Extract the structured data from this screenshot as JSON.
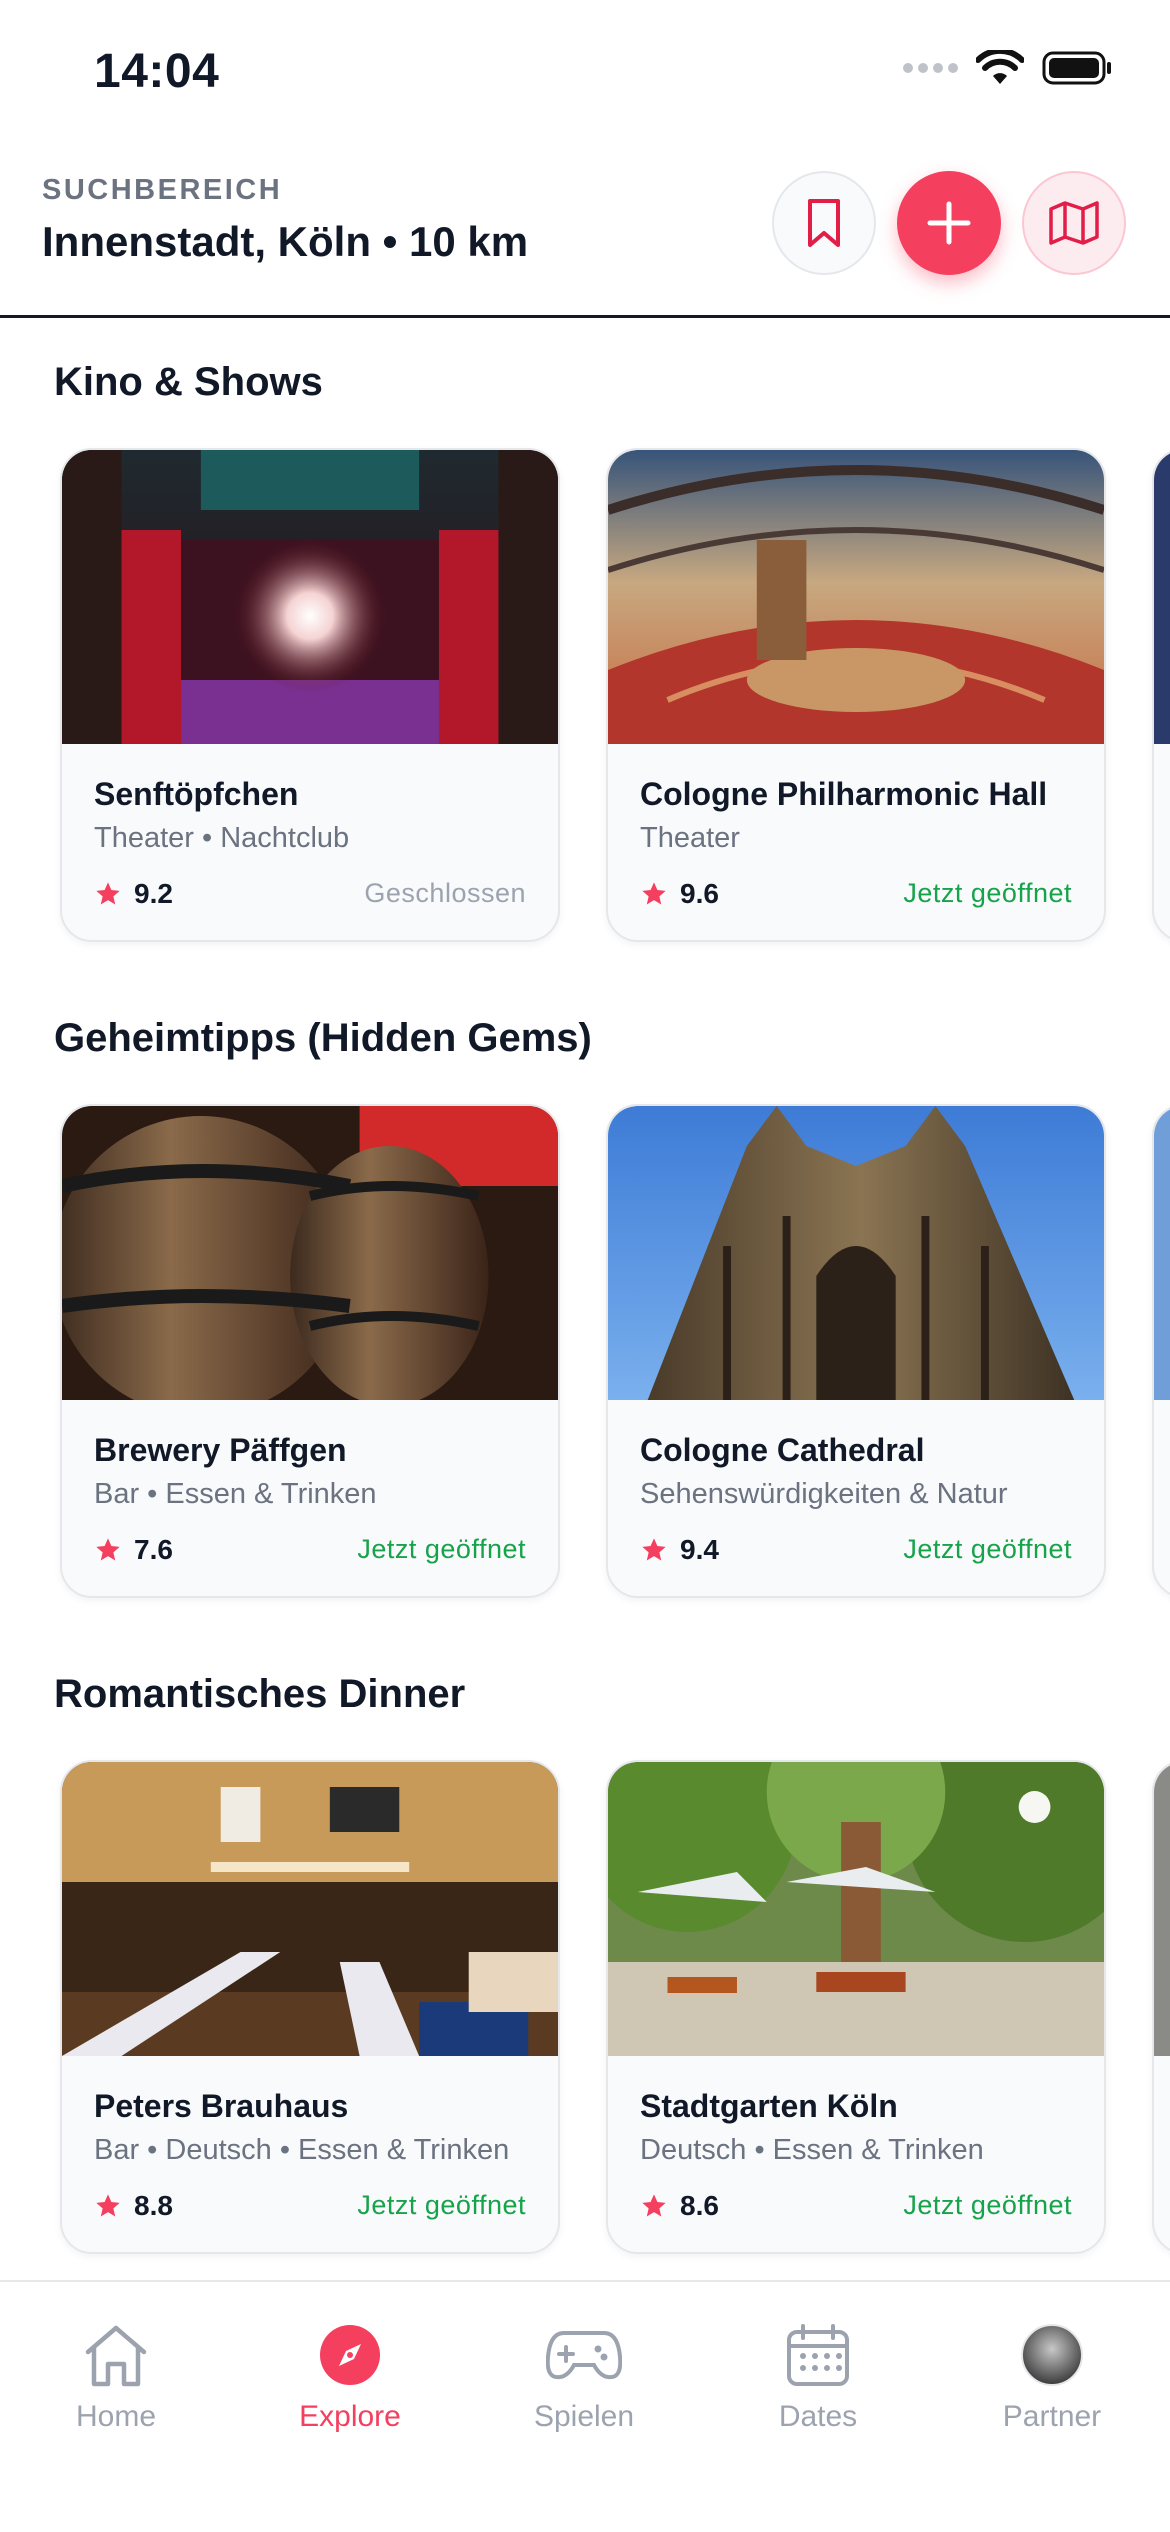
{
  "status_bar": {
    "time": "14:04"
  },
  "header": {
    "label": "SUCHBEREICH",
    "location": "Innenstadt, Köln • 10 km"
  },
  "sections": [
    {
      "title": "Kino & Shows",
      "cards": [
        {
          "title": "Senftöpfchen",
          "subtitle": "Theater • Nachtclub",
          "rating": "9.2",
          "status": "Geschlossen",
          "status_color": "#9ca3af",
          "image": "stage-photo"
        },
        {
          "title": "Cologne Philharmonic Hall",
          "subtitle": "Theater",
          "rating": "9.6",
          "status": "Jetzt geöffnet",
          "status_color": "#16a34a",
          "image": "concert-hall-photo"
        }
      ]
    },
    {
      "title": "Geheimtipps (Hidden Gems)",
      "cards": [
        {
          "title": "Brewery Päffgen",
          "subtitle": "Bar • Essen & Trinken",
          "rating": "7.6",
          "status": "Jetzt geöffnet",
          "status_color": "#16a34a",
          "image": "barrels-photo"
        },
        {
          "title": "Cologne Cathedral",
          "subtitle": "Sehenswürdigkeiten & Natur",
          "rating": "9.4",
          "status": "Jetzt geöffnet",
          "status_color": "#16a34a",
          "image": "cathedral-photo"
        }
      ]
    },
    {
      "title": "Romantisches Dinner",
      "cards": [
        {
          "title": "Peters Brauhaus",
          "subtitle": "Bar • Deutsch • Essen & Trinken",
          "rating": "8.8",
          "status": "Jetzt geöffnet",
          "status_color": "#16a34a",
          "image": "brauhaus-interior-photo"
        },
        {
          "title": "Stadtgarten Köln",
          "subtitle": "Deutsch • Essen & Trinken",
          "rating": "8.6",
          "status": "Jetzt geöffnet",
          "status_color": "#16a34a",
          "image": "beer-garden-photo"
        }
      ]
    }
  ],
  "tabbar": {
    "items": [
      {
        "label": "Home",
        "icon": "house-icon",
        "active": false
      },
      {
        "label": "Explore",
        "icon": "compass-icon",
        "active": true
      },
      {
        "label": "Spielen",
        "icon": "gamepad-icon",
        "active": false
      },
      {
        "label": "Dates",
        "icon": "calendar-icon",
        "active": false
      },
      {
        "label": "Partner",
        "icon": "partner-avatar",
        "active": false
      }
    ]
  },
  "colors": {
    "accent": "#f43f5e",
    "open": "#16a34a",
    "muted": "#9ca3af",
    "text": "#111827"
  }
}
